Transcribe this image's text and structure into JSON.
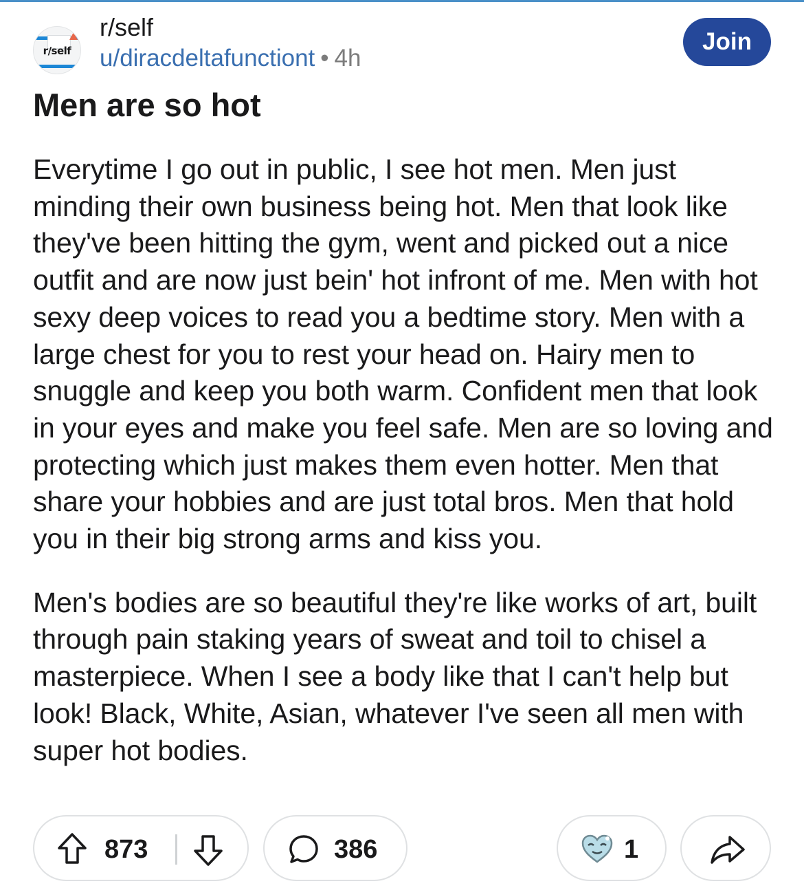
{
  "post": {
    "subreddit": "r/self",
    "avatar_text": "r/self",
    "author": "u/diracdeltafunctiont",
    "separator": "•",
    "age": "4h",
    "join_label": "Join",
    "title": "Men are so hot",
    "paragraphs": [
      "Everytime I go out in public, I see hot men. Men just minding their own business being hot. Men that look like they've been hitting the gym, went and picked out a nice outfit and are now just bein' hot infront of me. Men with hot sexy deep voices to read you a bedtime story. Men with a large chest for you to rest your head on. Hairy men to snuggle and keep you both warm. Confident men that look in your eyes and make you feel safe. Men are so loving and protecting which just makes them even hotter. Men that share your hobbies and are just total bros. Men that hold you in their big strong arms and kiss you.",
      "Men's bodies are so beautiful they're like works of art, built through pain staking years of sweat and toil to chisel a masterpiece. When I see a body like that I can't help but look! Black, White, Asian, whatever I've seen all men with super hot bodies."
    ]
  },
  "actions": {
    "upvotes": "873",
    "comments": "386",
    "awards": "1"
  },
  "icons": {
    "upvote": "upvote-arrow-icon",
    "downvote": "downvote-arrow-icon",
    "comment": "comment-bubble-icon",
    "award": "award-icon",
    "share": "share-arrow-icon"
  },
  "colors": {
    "join_bg": "#25489a",
    "author_link": "#3a6fb0",
    "meta_gray": "#7c7c7c",
    "pill_border": "#dfe1e3"
  }
}
